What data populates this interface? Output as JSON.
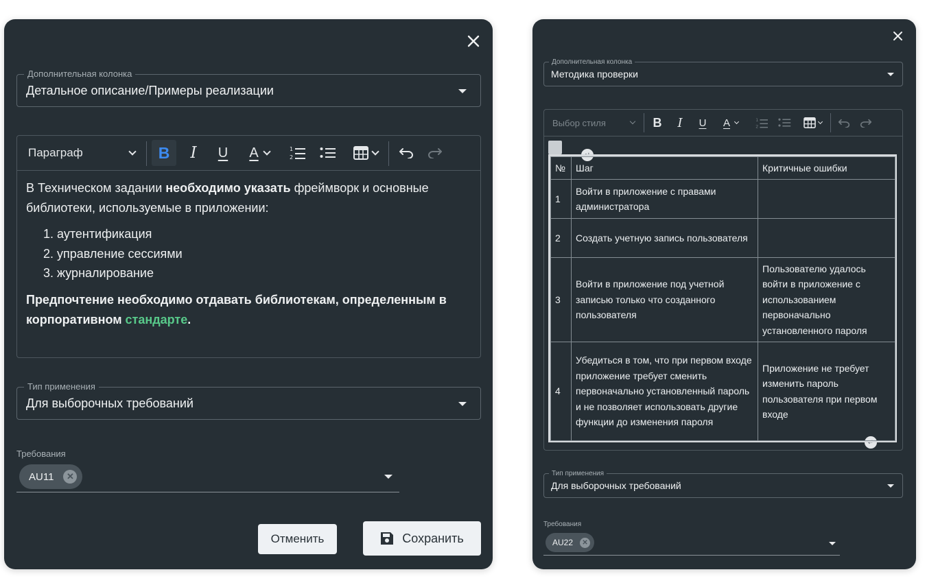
{
  "left_dialog": {
    "extra_column": {
      "legend": "Дополнительная колонка",
      "value": "Детальное описание/Примеры реализации"
    },
    "editor": {
      "style_select": "Параграф",
      "toolbar_icons": [
        "bold-icon",
        "italic-icon",
        "underline-icon",
        "font-color-icon",
        "numbered-list-icon",
        "bulleted-list-icon",
        "table-icon",
        "undo-icon",
        "redo-icon"
      ],
      "intro_pre": "В Техническом задании ",
      "intro_bold": "необходимо указать",
      "intro_post": " фреймворк и основные библиотеки, используемые в приложении:",
      "list": [
        "1. аутентификация",
        "2. управление сессиями",
        "3. журналирование"
      ],
      "closing_bold": "Предпочтение необходимо отдавать библиотекам, определенным в корпоративном ",
      "closing_link": "стандарте",
      "closing_end": "."
    },
    "application_type": {
      "legend": "Тип применения",
      "value": "Для выборочных требований"
    },
    "requirements": {
      "label": "Требования",
      "chip": "AU11"
    },
    "cancel_label": "Отменить",
    "save_label": "Сохранить"
  },
  "right_dialog": {
    "extra_column": {
      "legend": "Дополнительная колонка",
      "value": "Методика проверки"
    },
    "editor": {
      "style_select_placeholder": "Выбор стиля",
      "toolbar_icons": [
        "bold-icon",
        "italic-icon",
        "underline-icon",
        "font-color-icon",
        "numbered-list-icon",
        "bulleted-list-icon",
        "table-icon",
        "undo-icon",
        "redo-icon"
      ],
      "table": {
        "headers": [
          "№",
          "Шаг",
          "Критичные ошибки"
        ],
        "rows": [
          {
            "n": "1",
            "step": "Войти в приложение с правами администратора",
            "errors": ""
          },
          {
            "n": "2",
            "step": "Создать учетную запись пользователя",
            "errors": ""
          },
          {
            "n": "3",
            "step": "Войти в приложение под учетной записью только что созданного пользователя",
            "errors": "Пользователю удалось войти в приложение с использованием первоначально установленного пароля"
          },
          {
            "n": "4",
            "step": "Убедиться в том, что при первом входе приложение требует сменить первоначально установленный пароль и не позволяет использовать другие функции до изменения пароля",
            "errors": "Приложение не требует изменить пароль пользователя при первом входе"
          }
        ]
      }
    },
    "application_type": {
      "legend": "Тип применения",
      "value": "Для выборочных требований"
    },
    "requirements": {
      "label": "Требования",
      "chip": "AU22"
    }
  },
  "colors": {
    "panel_bg": "#262f35",
    "bold_active": "#3d8bf0",
    "link_green": "#58c98a"
  }
}
